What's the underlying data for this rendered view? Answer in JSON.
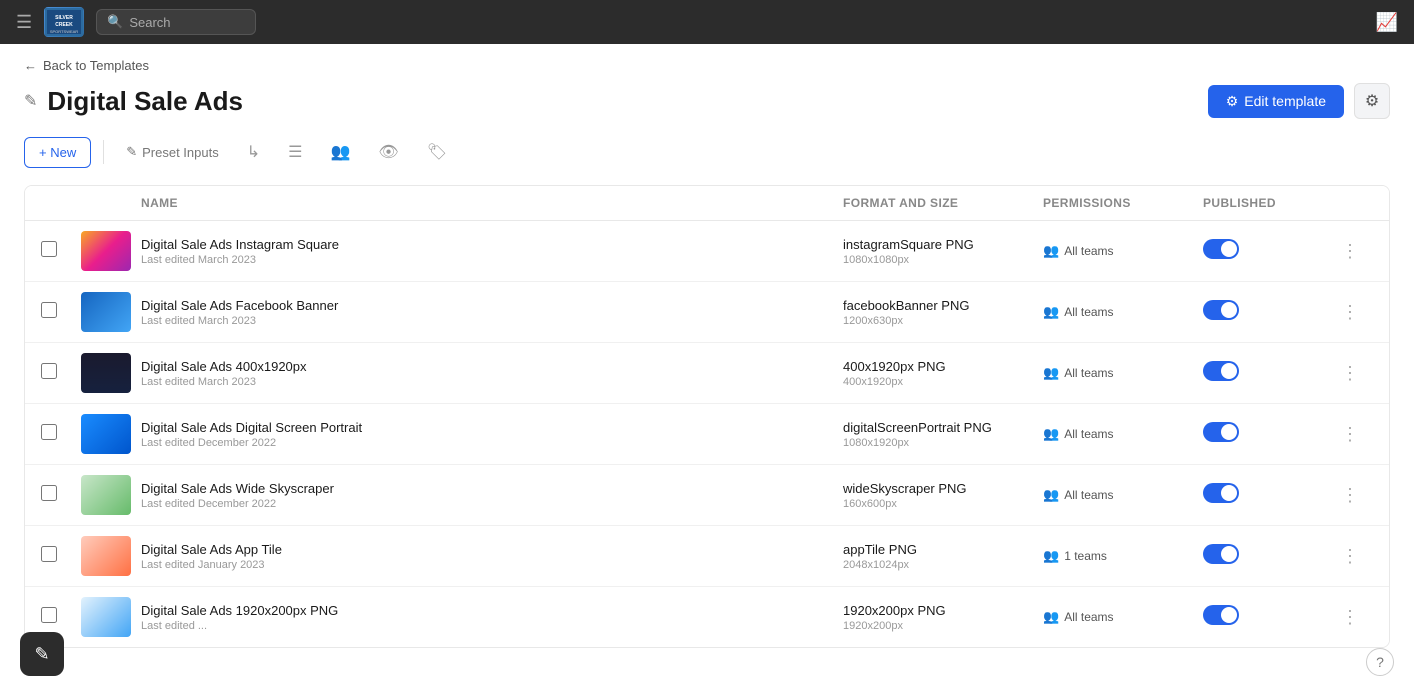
{
  "app": {
    "logo_alt": "Silver Creek Sportswear",
    "logo_initials": "SILVER\nCREEK"
  },
  "topnav": {
    "search_placeholder": "Search"
  },
  "breadcrumb": {
    "back_label": "Back to Templates"
  },
  "page": {
    "title": "Digital Sale Ads",
    "edit_template_label": "Edit template"
  },
  "toolbar": {
    "new_label": "+ New",
    "preset_inputs_label": "Preset Inputs"
  },
  "table": {
    "columns": {
      "name": "Name",
      "format": "Format and size",
      "permissions": "Permissions",
      "published": "Published"
    },
    "rows": [
      {
        "id": "instagram-square",
        "name": "Digital Sale Ads Instagram Square",
        "last_edited": "Last edited March 2023",
        "format_name": "instagramSquare PNG",
        "format_size": "1080x1080px",
        "permissions": "All teams",
        "published": true,
        "thumb_class": "thumb-instagram"
      },
      {
        "id": "facebook-banner",
        "name": "Digital Sale Ads Facebook Banner",
        "last_edited": "Last edited March 2023",
        "format_name": "facebookBanner PNG",
        "format_size": "1200x630px",
        "permissions": "All teams",
        "published": true,
        "thumb_class": "thumb-facebook"
      },
      {
        "id": "400x1920",
        "name": "Digital Sale Ads 400x1920px",
        "last_edited": "Last edited March 2023",
        "format_name": "400x1920px PNG",
        "format_size": "400x1920px",
        "permissions": "All teams",
        "published": true,
        "thumb_class": "thumb-400x1920"
      },
      {
        "id": "digital-screen-portrait",
        "name": "Digital Sale Ads Digital Screen Portrait",
        "last_edited": "Last edited December 2022",
        "format_name": "digitalScreenPortrait PNG",
        "format_size": "1080x1920px",
        "permissions": "All teams",
        "published": true,
        "thumb_class": "thumb-portrait"
      },
      {
        "id": "wide-skyscraper",
        "name": "Digital Sale Ads Wide Skyscraper",
        "last_edited": "Last edited December 2022",
        "format_name": "wideSkyscraper PNG",
        "format_size": "160x600px",
        "permissions": "All teams",
        "published": true,
        "thumb_class": "thumb-wide"
      },
      {
        "id": "app-tile",
        "name": "Digital Sale Ads App Tile",
        "last_edited": "Last edited January 2023",
        "format_name": "appTile PNG",
        "format_size": "2048x1024px",
        "permissions": "1 teams",
        "published": true,
        "thumb_class": "thumb-apptile"
      },
      {
        "id": "1920x200",
        "name": "Digital Sale Ads 1920x200px PNG",
        "last_edited": "Last edited ...",
        "format_name": "1920x200px PNG",
        "format_size": "1920x200px",
        "permissions": "All teams",
        "published": true,
        "thumb_class": "thumb-1920"
      }
    ]
  }
}
